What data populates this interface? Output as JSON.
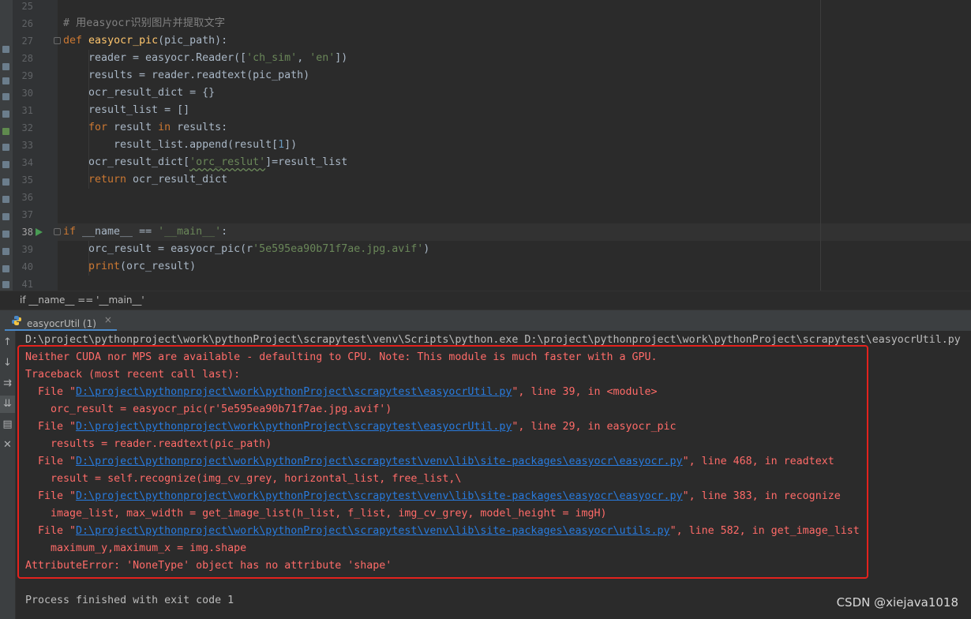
{
  "editor": {
    "line_numbers": [
      "25",
      "26",
      "27",
      "28",
      "29",
      "30",
      "31",
      "32",
      "33",
      "34",
      "35",
      "36",
      "37",
      "38",
      "39",
      "40",
      "41"
    ],
    "comment": "# 用easyocr识别图片并提取文字",
    "l27": {
      "kw": "def",
      "fn": "easyocr_pic",
      "rest": "(pic_path):"
    },
    "l28": {
      "a": "reader = easyocr.Reader([",
      "s1": "'ch_sim'",
      "c": ", ",
      "s2": "'en'",
      "b": "])"
    },
    "l29": "results = reader.readtext(pic_path)",
    "l30": "ocr_result_dict = {}",
    "l31": "result_list = []",
    "l32": {
      "kw1": "for",
      "a": " result ",
      "kw2": "in",
      "b": " results:"
    },
    "l33": {
      "a": "result_list.append(result[",
      "n": "1",
      "b": "])"
    },
    "l34": {
      "a": "ocr_result_dict[",
      "s": "'orc_reslut'",
      "b": "]=result_list"
    },
    "l35": {
      "kw": "return",
      "a": " ocr_result_dict"
    },
    "l38": {
      "kw": "if",
      "a": " __name__ == ",
      "s": "'__main__'",
      "b": ":"
    },
    "l39": {
      "a": "orc_result = easyocr_pic(r",
      "s": "'5e595ea90b71f7ae.jpg.avif'",
      "b": ")"
    },
    "l40": {
      "fn": "print",
      "a": "(orc_result)"
    }
  },
  "breadcrumb": "if __name__ == '__main__'",
  "run_tab": {
    "label": "easyocrUtil (1)",
    "close": "×"
  },
  "console": {
    "cmd": "D:\\project\\pythonproject\\work\\pythonProject\\scrapytest\\venv\\Scripts\\python.exe D:\\project\\pythonproject\\work\\pythonProject\\scrapytest\\easyocrUtil.py",
    "warn": "Neither CUDA nor MPS are available - defaulting to CPU. Note: This module is much faster with a GPU.",
    "tb": "Traceback (most recent call last):",
    "frames": [
      {
        "pre": "  File \"",
        "path": "D:\\project\\pythonproject\\work\\pythonProject\\scrapytest\\easyocrUtil.py",
        "post": "\", line 39, in <module>",
        "code": "    orc_result = easyocr_pic(r'5e595ea90b71f7ae.jpg.avif')"
      },
      {
        "pre": "  File \"",
        "path": "D:\\project\\pythonproject\\work\\pythonProject\\scrapytest\\easyocrUtil.py",
        "post": "\", line 29, in easyocr_pic",
        "code": "    results = reader.readtext(pic_path)"
      },
      {
        "pre": "  File \"",
        "path": "D:\\project\\pythonproject\\work\\pythonProject\\scrapytest\\venv\\lib\\site-packages\\easyocr\\easyocr.py",
        "post": "\", line 468, in readtext",
        "code": "    result = self.recognize(img_cv_grey, horizontal_list, free_list,\\"
      },
      {
        "pre": "  File \"",
        "path": "D:\\project\\pythonproject\\work\\pythonProject\\scrapytest\\venv\\lib\\site-packages\\easyocr\\easyocr.py",
        "post": "\", line 383, in recognize",
        "code": "    image_list, max_width = get_image_list(h_list, f_list, img_cv_grey, model_height = imgH)"
      },
      {
        "pre": "  File \"",
        "path": "D:\\project\\pythonproject\\work\\pythonProject\\scrapytest\\venv\\lib\\site-packages\\easyocr\\utils.py",
        "post": "\", line 582, in get_image_list",
        "code": "    maximum_y,maximum_x = img.shape"
      }
    ],
    "error": "AttributeError: 'NoneType' object has no attribute 'shape'",
    "exit": "Process finished with exit code 1"
  },
  "watermark": "CSDN @xiejava1018",
  "colors": {
    "error": "#ff6b68",
    "link": "#287bde",
    "highlight_box": "#e3221d"
  }
}
